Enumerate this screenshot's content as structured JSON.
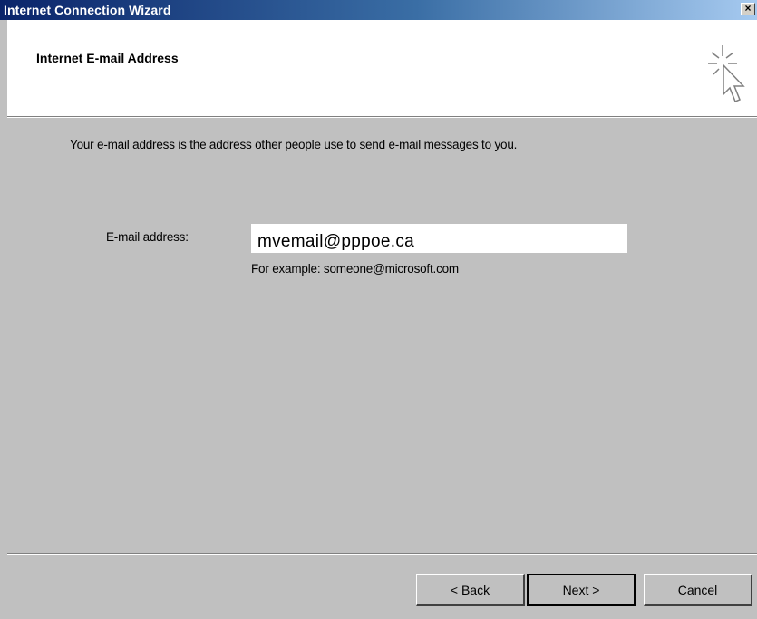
{
  "window": {
    "title": "Internet Connection Wizard",
    "close_glyph": "×"
  },
  "header": {
    "heading": "Internet E-mail Address",
    "icon": "wizard-cursor-sparkle-icon"
  },
  "body": {
    "intro": "Your e-mail address is the address other people use to send e-mail messages to you.",
    "email_label": "E-mail address:",
    "email_value": "mvemail@pppoe.ca",
    "example_text": "For example: someone@microsoft.com"
  },
  "buttons": {
    "back": "< Back",
    "next": "Next >",
    "cancel": "Cancel"
  }
}
